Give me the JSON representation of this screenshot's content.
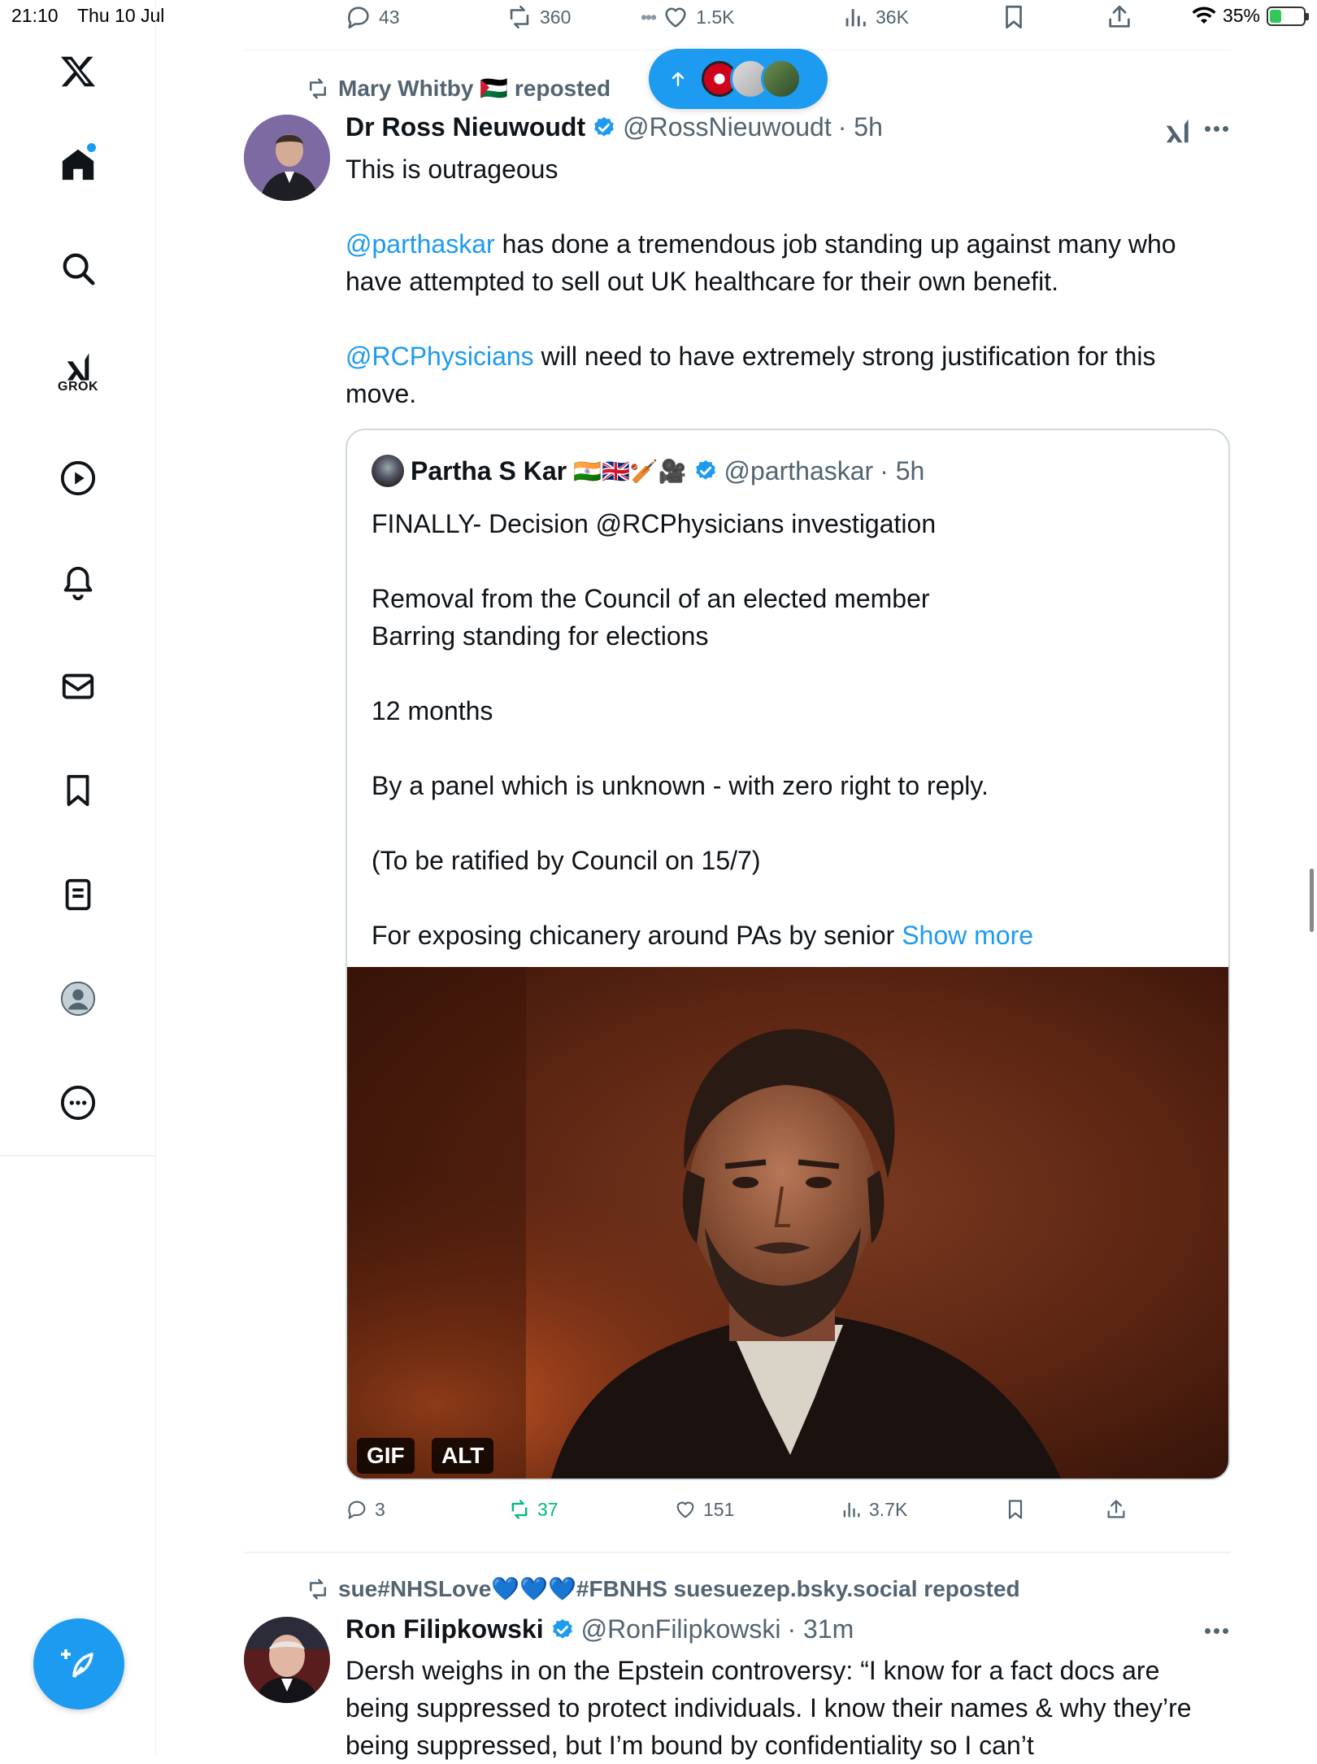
{
  "status_bar": {
    "time": "21:10",
    "date": "Thu 10 Jul",
    "battery": "35%",
    "battery_level": 0.35
  },
  "sidebar": {
    "items": [
      {
        "name": "home",
        "label": "Home"
      },
      {
        "name": "explore",
        "label": "Explore"
      },
      {
        "name": "grok",
        "label": "GROK"
      },
      {
        "name": "video",
        "label": "Video"
      },
      {
        "name": "notifications",
        "label": "Notifications"
      },
      {
        "name": "messages",
        "label": "Messages"
      },
      {
        "name": "bookmarks",
        "label": "Bookmarks"
      },
      {
        "name": "lists",
        "label": "Lists"
      },
      {
        "name": "profile",
        "label": "Profile"
      },
      {
        "name": "more",
        "label": "More"
      }
    ],
    "compose_label": "Post"
  },
  "top_actions": {
    "replies": "43",
    "reposts": "360",
    "likes": "1.5K",
    "views": "36K"
  },
  "colors": {
    "accent": "#1d9bf0",
    "text": "#0f1419",
    "muted": "#536471",
    "repost_green": "#00ba7c"
  },
  "tweet1": {
    "reposted_by": "Mary Whitby 🇵🇸 reposted",
    "name": "Dr Ross Nieuwoudt",
    "handle": "@RossNieuwoudt",
    "time": "· 5h",
    "body": {
      "line1": "This is outrageous",
      "mention1": "@parthaskar",
      "text2": " has done a tremendous job standing up against many who have attempted to sell out UK healthcare for their own benefit.",
      "mention2": "@RCPhysicians",
      "text3": " will need to have extremely strong justification for this move."
    },
    "quote": {
      "name": "Partha S Kar",
      "emojis": "🇮🇳🇬🇧🏏🎥",
      "handle": "@parthaskar",
      "time": "· 5h",
      "lines": [
        "FINALLY- Decision @RCPhysicians investigation",
        "",
        "Removal from the Council of an elected member",
        "Barring standing for elections",
        "",
        "12 months",
        "",
        "By a panel which is unknown - with zero right to reply.",
        "",
        "(To be ratified by Council on 15/7)",
        ""
      ],
      "last_line": "For exposing chicanery around PAs by senior ",
      "show_more": "Show more",
      "badges": {
        "gif": "GIF",
        "alt": "ALT"
      }
    },
    "actions": {
      "replies": "3",
      "reposts": "37",
      "likes": "151",
      "views": "3.7K"
    }
  },
  "tweet2": {
    "reposted_by": "sue#NHSLove💙💙💙#FBNHS suesuezep.bsky.social reposted",
    "name": "Ron Filipkowski",
    "handle": "@RonFilipkowski",
    "time": "· 31m",
    "body": "Dersh weighs in on the Epstein controversy: “I know for a fact docs are being suppressed to protect individuals. I know their names & why they’re being suppressed, but I’m bound by confidentiality so I can’t"
  }
}
